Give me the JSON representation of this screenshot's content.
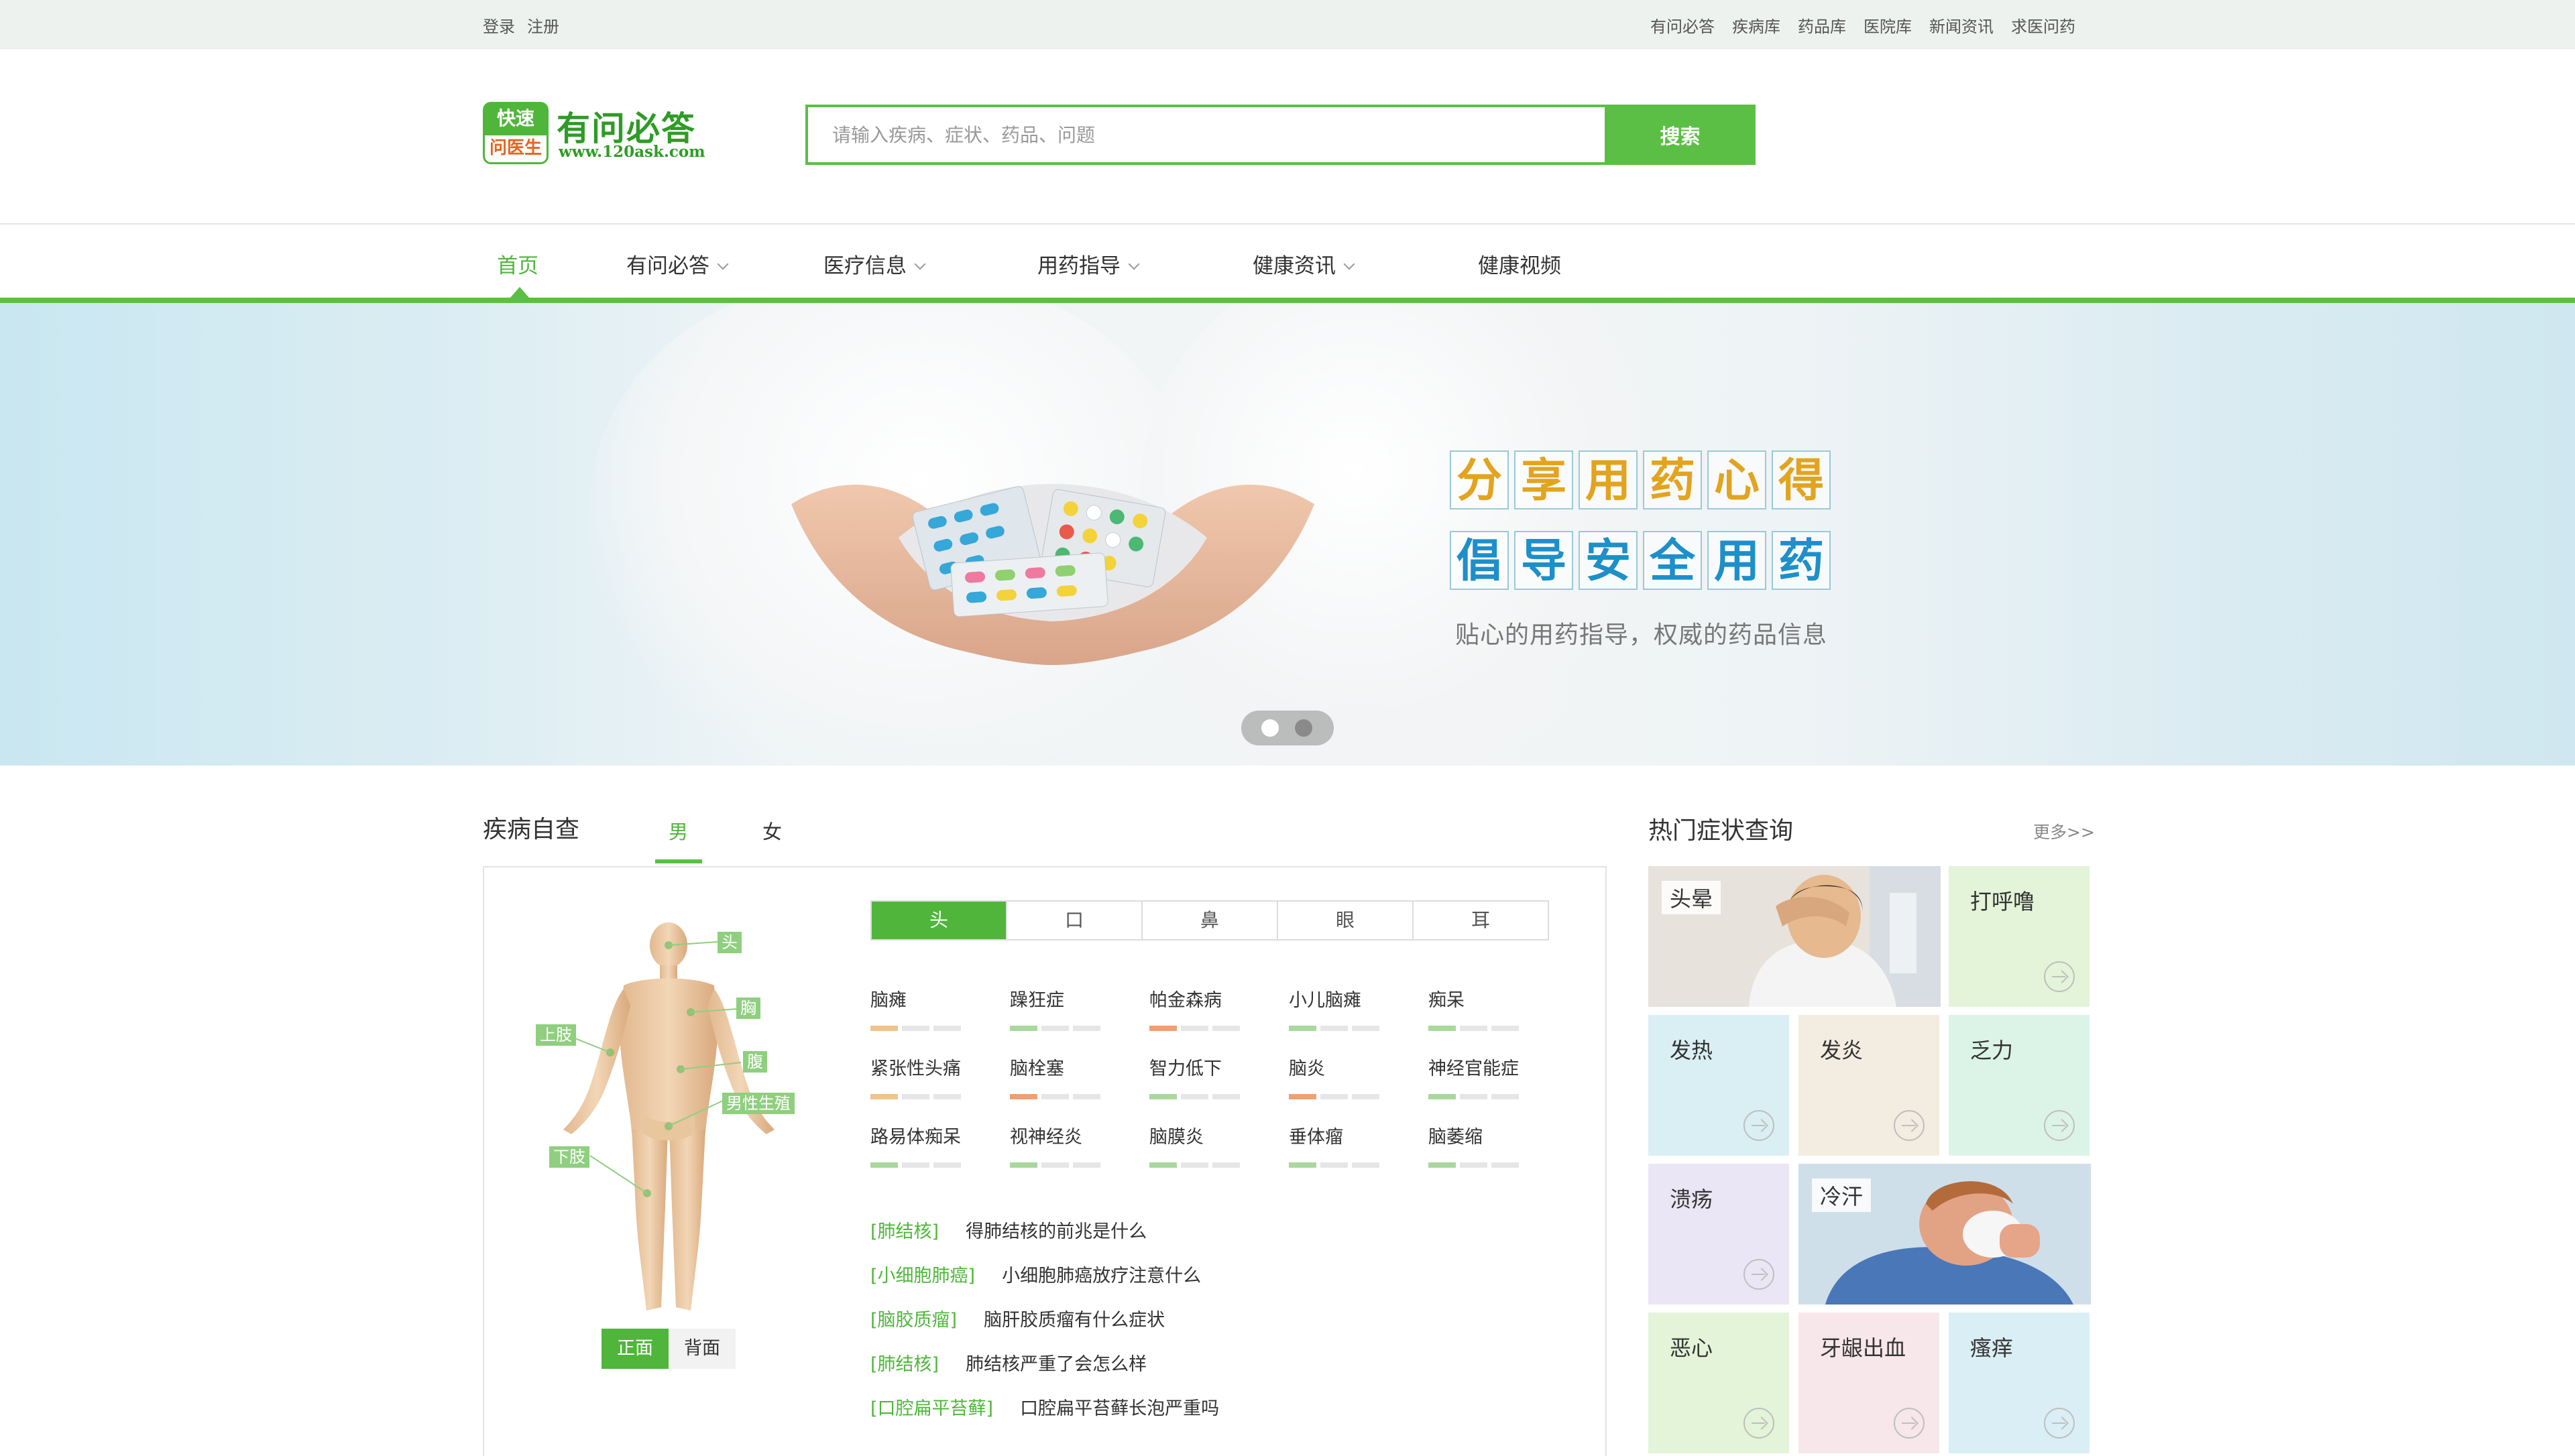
{
  "topbar": {
    "login": "登录",
    "register": "注册",
    "links": [
      "有问必答",
      "疾病库",
      "药品库",
      "医院库",
      "新闻资讯",
      "求医问药"
    ]
  },
  "header": {
    "logo_top": "快速",
    "logo_bottom": "问医生",
    "logo_title": "有问必答",
    "logo_url": "www.120ask.com",
    "search_placeholder": "请输入疾病、症状、药品、问题",
    "search_button": "搜索"
  },
  "nav": {
    "items": [
      {
        "label": "首页",
        "dropdown": false
      },
      {
        "label": "有问必答",
        "dropdown": true
      },
      {
        "label": "医疗信息",
        "dropdown": true
      },
      {
        "label": "用药指导",
        "dropdown": true
      },
      {
        "label": "健康资讯",
        "dropdown": true
      },
      {
        "label": "健康视频",
        "dropdown": false
      }
    ],
    "active_index": 0
  },
  "banner": {
    "line1": [
      "分",
      "享",
      "用",
      "药",
      "心",
      "得"
    ],
    "line2": [
      "倡",
      "导",
      "安",
      "全",
      "用",
      "药"
    ],
    "subtitle": "贴心的用药指导，权威的药品信息",
    "slide_count": 2,
    "active_slide": 0
  },
  "self_check": {
    "title": "疾病自查",
    "gender_tabs": [
      "男",
      "女"
    ],
    "active_gender": 0,
    "body_labels": [
      "头",
      "胸",
      "上肢",
      "腹",
      "男性生殖",
      "下肢"
    ],
    "view_front": "正面",
    "view_back": "背面",
    "part_tabs": [
      "头",
      "口",
      "鼻",
      "眼",
      "耳"
    ],
    "active_part": 0,
    "diseases": [
      {
        "name": "脑瘫",
        "level": 1,
        "color": "#f0c48a"
      },
      {
        "name": "躁狂症",
        "level": 1,
        "color": "#a9d89c"
      },
      {
        "name": "帕金森病",
        "level": 1,
        "color": "#f0a070"
      },
      {
        "name": "小儿脑瘫",
        "level": 1,
        "color": "#a9d89c"
      },
      {
        "name": "痴呆",
        "level": 1,
        "color": "#a9d89c"
      },
      {
        "name": "紧张性头痛",
        "level": 1,
        "color": "#f0c48a"
      },
      {
        "name": "脑栓塞",
        "level": 1,
        "color": "#f0a070"
      },
      {
        "name": "智力低下",
        "level": 1,
        "color": "#a9d89c"
      },
      {
        "name": "脑炎",
        "level": 1,
        "color": "#f0a070"
      },
      {
        "name": "神经官能症",
        "level": 1,
        "color": "#a9d89c"
      },
      {
        "name": "路易体痴呆",
        "level": 1,
        "color": "#a9d89c"
      },
      {
        "name": "视神经炎",
        "level": 1,
        "color": "#a9d89c"
      },
      {
        "name": "脑膜炎",
        "level": 1,
        "color": "#a9d89c"
      },
      {
        "name": "垂体瘤",
        "level": 1,
        "color": "#a9d89c"
      },
      {
        "name": "脑萎缩",
        "level": 1,
        "color": "#a9d89c"
      }
    ],
    "questions": [
      {
        "tag": "[肺结核]",
        "text": "得肺结核的前兆是什么"
      },
      {
        "tag": "[小细胞肺癌]",
        "text": "小细胞肺癌放疗注意什么"
      },
      {
        "tag": "[脑胶质瘤]",
        "text": "脑肝胶质瘤有什么症状"
      },
      {
        "tag": "[肺结核]",
        "text": "肺结核严重了会怎么样"
      },
      {
        "tag": "[口腔扁平苔藓]",
        "text": "口腔扁平苔藓长泡严重吗"
      }
    ]
  },
  "hot_symptoms": {
    "title": "热门症状查询",
    "more": "更多>>",
    "tiles": [
      {
        "label": "头晕",
        "color": "#e9e4dc",
        "photo": true
      },
      {
        "label": "打呼噜",
        "color": "#e3f4d8",
        "photo": false
      },
      {
        "label": "发热",
        "color": "#d9eff3",
        "photo": false
      },
      {
        "label": "发炎",
        "color": "#f3ece0",
        "photo": false
      },
      {
        "label": "乏力",
        "color": "#dcf4e8",
        "photo": false
      },
      {
        "label": "溃疡",
        "color": "#ebe6f5",
        "photo": false
      },
      {
        "label": "冷汗",
        "color": "#d8e6f0",
        "photo": true
      },
      {
        "label": "恶心",
        "color": "#e3f4d8",
        "photo": false
      },
      {
        "label": "牙龈出血",
        "color": "#f7e6ea",
        "photo": false
      },
      {
        "label": "瘙痒",
        "color": "#d9eff5",
        "photo": false
      }
    ]
  }
}
